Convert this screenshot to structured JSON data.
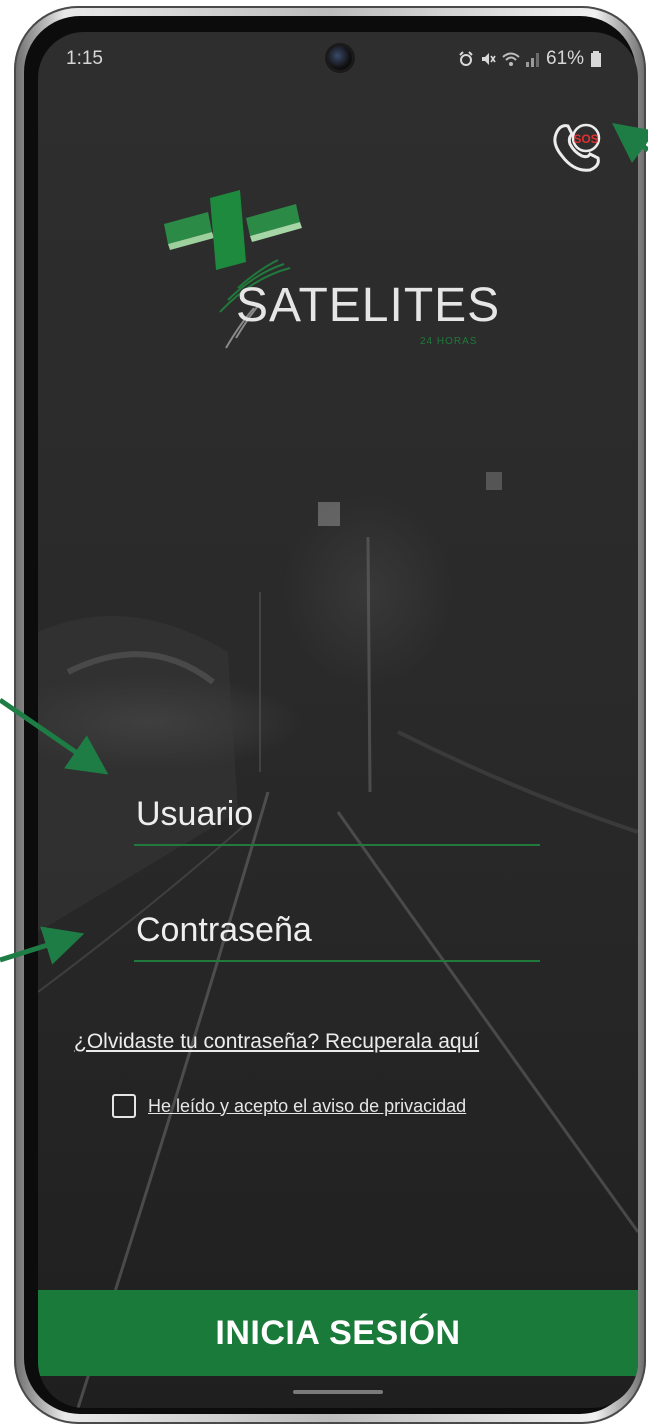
{
  "status_bar": {
    "time": "1:15",
    "battery": "61%",
    "icons": [
      "alarm-icon",
      "mute-icon",
      "wifi-icon",
      "signal-icon",
      "battery-icon"
    ]
  },
  "sos": {
    "label": "SOS",
    "icon": "sos-phone-icon"
  },
  "brand": {
    "name": "SATELITES",
    "tagline": "24 HORAS",
    "accent": "#1a7a3a"
  },
  "form": {
    "username_placeholder": "Usuario",
    "password_placeholder": "Contraseña",
    "forgot_link": "¿Olvidaste tu contraseña? Recuperala aquí",
    "privacy_checkbox_label": "He leído y acepto el aviso de privacidad",
    "privacy_checked": false,
    "login_button": "INICIA SESIÓN"
  },
  "colors": {
    "accent_green": "#1a7a3a",
    "annotation_arrow": "#1e7d45",
    "sos_red": "#e03131",
    "background": "#2a2a2a"
  }
}
